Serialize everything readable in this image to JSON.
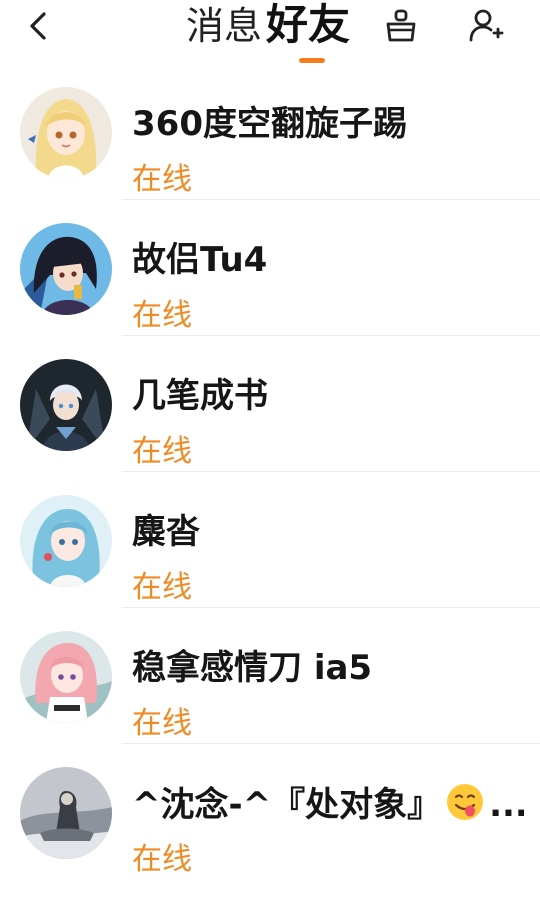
{
  "header": {
    "tab_messages": "消息",
    "tab_friends": "好友",
    "active_tab": "tab_friends",
    "icons": [
      "back-arrow-icon",
      "sweep-brush-icon",
      "add-friend-icon"
    ]
  },
  "colors": {
    "accent": "#f57c1f",
    "online": "#f08a24"
  },
  "friends": [
    {
      "name": "360度空翻旋子踢",
      "status": "在线",
      "avatar": "blonde-girl-avatar"
    },
    {
      "name": "故侣Tu4",
      "status": "在线",
      "avatar": "dark-hair-boy-avatar"
    },
    {
      "name": "几笔成书",
      "status": "在线",
      "avatar": "armored-boy-avatar"
    },
    {
      "name": "麋沓",
      "status": "在线",
      "avatar": "blue-hair-girl-avatar"
    },
    {
      "name": "稳拿感情刀 ia5",
      "status": "在线",
      "avatar": "pink-hair-girl-avatar"
    },
    {
      "name": "^沈念-^『处对象』",
      "name_suffix": "...",
      "status": "在线",
      "avatar": "gray-mist-avatar",
      "emoji": "smiling-face-tongue-emoji"
    }
  ]
}
